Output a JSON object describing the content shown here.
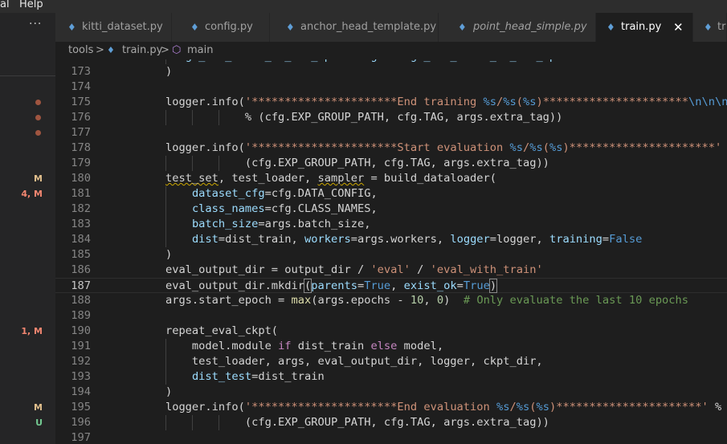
{
  "menu": [
    "al",
    "Help"
  ],
  "ellipsis": "···",
  "tabs": [
    {
      "label": "kitti_dataset.py",
      "active": false,
      "italic": false
    },
    {
      "label": "config.py",
      "active": false,
      "italic": false
    },
    {
      "label": "anchor_head_template.py",
      "active": false,
      "italic": false
    },
    {
      "label": "point_head_simple.py",
      "active": false,
      "italic": true
    },
    {
      "label": "train.py",
      "active": true,
      "italic": false
    },
    {
      "label": "tr",
      "active": false,
      "italic": false
    }
  ],
  "breadcrumbs": {
    "folder": "tools",
    "sep": ">",
    "file": "train.py",
    "symbol": "main"
  },
  "gutter_badges": [
    {
      "line": 180,
      "text": "M",
      "color": "#e2c08d"
    },
    {
      "line": 181,
      "text": "4, M",
      "color": "#f48771"
    },
    {
      "line": 190,
      "text": "1, M",
      "color": "#f48771"
    },
    {
      "line": 195,
      "text": "M",
      "color": "#e2c08d"
    },
    {
      "line": 196,
      "text": "U",
      "color": "#73c991"
    }
  ],
  "gutter_dots": [
    175,
    176,
    177
  ],
  "lines": [
    {
      "num": "",
      "segs": [
        [
          "    "
        ],
        [
          "merge_all_iters_to_one_epoch=args.merge_all_iters_to_one_epoch",
          "p"
        ]
      ]
    },
    {
      "num": "173",
      "segs": [
        [
          "    )"
        ]
      ]
    },
    {
      "num": "174",
      "segs": []
    },
    {
      "num": "175",
      "segs": [
        [
          "    logger.info("
        ],
        [
          "'**********************End training ",
          "s"
        ],
        [
          "%s",
          "b"
        ],
        [
          "/",
          "s"
        ],
        [
          "%s",
          "b"
        ],
        [
          "(",
          "s"
        ],
        [
          "%s",
          "b"
        ],
        [
          ")**********************",
          "s"
        ],
        [
          "\\n\\n\\n",
          "b"
        ],
        [
          "'",
          "s"
        ]
      ]
    },
    {
      "num": "176",
      "segs": [
        [
          "                "
        ],
        [
          "% (cfg.EXP_GROUP_PATH, cfg.TAG, args.extra_tag))"
        ]
      ]
    },
    {
      "num": "177",
      "segs": []
    },
    {
      "num": "178",
      "segs": [
        [
          "    logger.info("
        ],
        [
          "'**********************Start evaluation ",
          "s"
        ],
        [
          "%s",
          "b"
        ],
        [
          "/",
          "s"
        ],
        [
          "%s",
          "b"
        ],
        [
          "(",
          "s"
        ],
        [
          "%s",
          "b"
        ],
        [
          ")**********************'",
          "s"
        ],
        [
          " %"
        ]
      ]
    },
    {
      "num": "179",
      "segs": [
        [
          "                "
        ],
        [
          "(cfg.EXP_GROUP_PATH, cfg.TAG, args.extra_tag))"
        ]
      ]
    },
    {
      "num": "180",
      "segs": [
        [
          "    "
        ],
        [
          "test_set",
          "sq"
        ],
        [
          ", test_loader, "
        ],
        [
          "sampler",
          "sq"
        ],
        [
          " = build_dataloader("
        ]
      ]
    },
    {
      "num": "181",
      "segs": [
        [
          "        "
        ],
        [
          "dataset_cfg",
          "p"
        ],
        [
          "=cfg.DATA_CONFIG,"
        ]
      ]
    },
    {
      "num": "182",
      "segs": [
        [
          "        "
        ],
        [
          "class_names",
          "p"
        ],
        [
          "=cfg.CLASS_NAMES,"
        ]
      ]
    },
    {
      "num": "183",
      "segs": [
        [
          "        "
        ],
        [
          "batch_size",
          "p"
        ],
        [
          "=args.batch_size,"
        ]
      ]
    },
    {
      "num": "184",
      "segs": [
        [
          "        "
        ],
        [
          "dist",
          "p"
        ],
        [
          "=dist_train, "
        ],
        [
          "workers",
          "p"
        ],
        [
          "=args.workers, "
        ],
        [
          "logger",
          "p"
        ],
        [
          "=logger, "
        ],
        [
          "training",
          "p"
        ],
        [
          "="
        ],
        [
          "False",
          "b"
        ]
      ]
    },
    {
      "num": "185",
      "segs": [
        [
          "    )"
        ]
      ]
    },
    {
      "num": "186",
      "segs": [
        [
          "    eval_output_dir = output_dir / "
        ],
        [
          "'eval'",
          "s"
        ],
        [
          " / "
        ],
        [
          "'eval_with_train'",
          "s"
        ]
      ]
    },
    {
      "num": "187",
      "segs": [
        [
          "    eval_output_dir.mkdir"
        ],
        [
          "(",
          "br"
        ],
        [
          "parents",
          "p"
        ],
        [
          "="
        ],
        [
          "True",
          "b"
        ],
        [
          ", "
        ],
        [
          "exist_ok",
          "p"
        ],
        [
          "="
        ],
        [
          "True",
          "b"
        ],
        [
          ")",
          "br"
        ]
      ],
      "current": true
    },
    {
      "num": "188",
      "segs": [
        [
          "    args.start_epoch = "
        ],
        [
          "max",
          "f"
        ],
        [
          "(args.epochs - "
        ],
        [
          "10",
          "n"
        ],
        [
          ", "
        ],
        [
          "0",
          "n"
        ],
        [
          ")  "
        ],
        [
          "# Only evaluate the last 10 epochs",
          "c"
        ]
      ]
    },
    {
      "num": "189",
      "segs": []
    },
    {
      "num": "190",
      "segs": [
        [
          "    repeat_eval_ckpt("
        ]
      ]
    },
    {
      "num": "191",
      "segs": [
        [
          "        model.module "
        ],
        [
          "if",
          "k"
        ],
        [
          " dist_train "
        ],
        [
          "else",
          "k"
        ],
        [
          " model,"
        ]
      ]
    },
    {
      "num": "192",
      "segs": [
        [
          "        test_loader, args, eval_output_dir, logger, ckpt_dir,"
        ]
      ]
    },
    {
      "num": "193",
      "segs": [
        [
          "        "
        ],
        [
          "dist_test",
          "p"
        ],
        [
          "=dist_train"
        ]
      ]
    },
    {
      "num": "194",
      "segs": [
        [
          "    )"
        ]
      ]
    },
    {
      "num": "195",
      "segs": [
        [
          "    logger.info("
        ],
        [
          "'**********************End evaluation ",
          "s"
        ],
        [
          "%s",
          "b"
        ],
        [
          "/",
          "s"
        ],
        [
          "%s",
          "b"
        ],
        [
          "(",
          "s"
        ],
        [
          "%s",
          "b"
        ],
        [
          ")**********************'",
          "s"
        ],
        [
          " %"
        ]
      ]
    },
    {
      "num": "196",
      "segs": [
        [
          "                "
        ],
        [
          "(cfg.EXP_GROUP_PATH, cfg.TAG, args.extra_tag))"
        ]
      ]
    },
    {
      "num": "197",
      "segs": []
    }
  ]
}
